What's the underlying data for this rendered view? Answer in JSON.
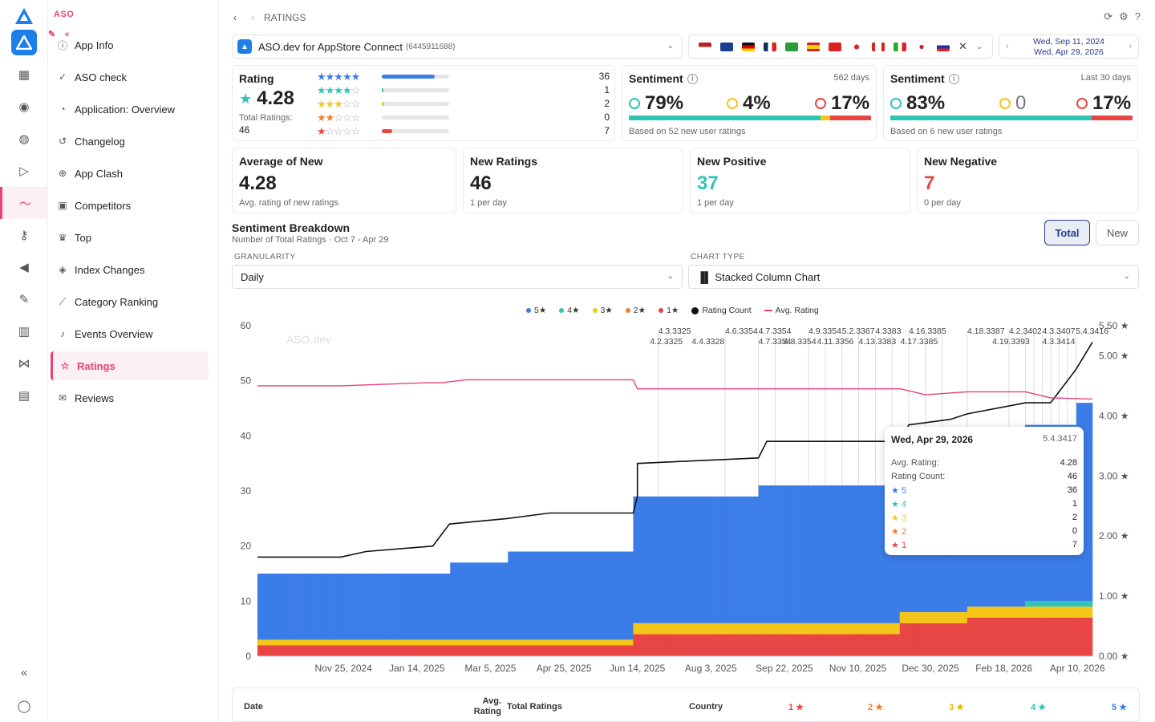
{
  "sidebar": {
    "brand": "ASO",
    "items": [
      {
        "label": "App Info",
        "icon": "info-icon"
      },
      {
        "label": "ASO check",
        "icon": "check-circle-icon"
      },
      {
        "label": "Application: Overview",
        "icon": "overview-icon"
      },
      {
        "label": "Changelog",
        "icon": "history-icon"
      },
      {
        "label": "App Clash",
        "icon": "clash-icon"
      },
      {
        "label": "Competitors",
        "icon": "competitors-icon"
      },
      {
        "label": "Top",
        "icon": "trophy-icon"
      },
      {
        "label": "Index Changes",
        "icon": "index-icon"
      },
      {
        "label": "Category Ranking",
        "icon": "ranking-chart-icon"
      },
      {
        "label": "Events Overview",
        "icon": "bell-icon"
      },
      {
        "label": "Ratings",
        "icon": "star-icon"
      },
      {
        "label": "Reviews",
        "icon": "reviews-icon"
      }
    ],
    "active": "Ratings"
  },
  "header": {
    "breadcrumb": "RATINGS"
  },
  "app_selector": {
    "name": "ASO.dev for AppStore Connect",
    "id": "(6445911688)"
  },
  "date_range": {
    "from": "Wed, Sep 11, 2024",
    "to": "Wed, Apr 29, 2026"
  },
  "rating_card": {
    "title": "Rating",
    "value": "4.28",
    "total_label": "Total Ratings:",
    "total": "46",
    "rows": [
      {
        "stars": 5,
        "count": "36",
        "fill": 0.78,
        "color": "#3b7de8"
      },
      {
        "stars": 4,
        "count": "1",
        "fill": 0.02,
        "color": "#2ec4b6"
      },
      {
        "stars": 3,
        "count": "2",
        "fill": 0.04,
        "color": "#f5c518"
      },
      {
        "stars": 2,
        "count": "0",
        "fill": 0,
        "color": "#f08030"
      },
      {
        "stars": 1,
        "count": "7",
        "fill": 0.15,
        "color": "#e84545"
      }
    ]
  },
  "sentiment_all": {
    "title": "Sentiment",
    "period": "562 days",
    "pos": "79%",
    "neu": "4%",
    "neg": "17%",
    "note": "Based on 52 new user ratings"
  },
  "sentiment_30": {
    "title": "Sentiment",
    "period": "Last 30 days",
    "pos": "83%",
    "neu": "0",
    "neg": "17%",
    "note": "Based on 6 new user ratings"
  },
  "stats": [
    {
      "title": "Average of New",
      "value": "4.28",
      "sub": "Avg. rating of new ratings",
      "color": "#222"
    },
    {
      "title": "New Ratings",
      "value": "46",
      "sub": "1 per day",
      "color": "#222"
    },
    {
      "title": "New Positive",
      "value": "37",
      "sub": "1 per day",
      "color": "#2ec4b6"
    },
    {
      "title": "New Negative",
      "value": "7",
      "sub": "0 per day",
      "color": "#e84545"
    }
  ],
  "breakdown": {
    "title": "Sentiment Breakdown",
    "subtitle": "Number of Total Ratings · Oct 7 - Apr 29",
    "btn_total": "Total",
    "btn_new": "New",
    "granularity_label": "GRANULARITY",
    "granularity": "Daily",
    "chart_type_label": "CHART TYPE",
    "chart_type": "Stacked Column Chart"
  },
  "legend": [
    "5★",
    "4★",
    "3★",
    "2★",
    "1★",
    "Rating Count",
    "Avg. Rating"
  ],
  "watermark": "ASO.dev",
  "tooltip": {
    "date": "Wed, Apr 29, 2026",
    "version": "5.4.3417",
    "avg_label": "Avg. Rating:",
    "avg": "4.28",
    "count_label": "Rating Count:",
    "count": "46",
    "rows": [
      {
        "label": "5",
        "value": "36",
        "color": "#3b7de8"
      },
      {
        "label": "4",
        "value": "1",
        "color": "#2ec4b6"
      },
      {
        "label": "3",
        "value": "2",
        "color": "#f5c518"
      },
      {
        "label": "2",
        "value": "0",
        "color": "#f08030"
      },
      {
        "label": "1",
        "value": "7",
        "color": "#e84545"
      }
    ]
  },
  "version_labels": {
    "row1": [
      "4.3.3325",
      "4.6.3354",
      "4.7.3354",
      "4.9.3354",
      "5.2.3367",
      "4.3383",
      "4.16.3385",
      "4.18.3387",
      "4.2.3402",
      "4.3.3407",
      "5.4.3416"
    ],
    "row2": [
      "4.2.3325",
      "4.4.3328",
      "4.7.3354",
      "4.8.3354",
      "4.11.3356",
      "4.13.3383",
      "4.17.3385",
      "4.19.3393",
      "4.3.3414"
    ]
  },
  "table_header": [
    "Date",
    "Avg. Rating",
    "Total Ratings",
    "Country",
    "1 ★",
    "2 ★",
    "3 ★",
    "4 ★",
    "5 ★"
  ],
  "chart_data": {
    "type": "bar",
    "stacked": true,
    "x": [
      "Nov 25, 2024",
      "Jan 14, 2025",
      "Mar 5, 2025",
      "Apr 25, 2025",
      "Jun 14, 2025",
      "Aug 3, 2025",
      "Sep 22, 2025",
      "Nov 10, 2025",
      "Dec 30, 2025",
      "Feb 18, 2026",
      "Apr 10, 2026"
    ],
    "x_range": [
      "Oct 7, 2024",
      "Apr 29, 2026"
    ],
    "ylim": [
      0,
      60
    ],
    "yticks": [
      0,
      10,
      20,
      30,
      40,
      50,
      60
    ],
    "y2lim": [
      0,
      5.5
    ],
    "y2ticks": [
      "0.00 ★",
      "1.00 ★",
      "2.00 ★",
      "3.00 ★",
      "4.00 ★",
      "5.00 ★",
      "5.50 ★"
    ],
    "series": [
      {
        "name": "1★",
        "color": "#e84545",
        "steps": [
          [
            0,
            2
          ],
          [
            0.45,
            2
          ],
          [
            0.45,
            4
          ],
          [
            0.77,
            4
          ],
          [
            0.77,
            6
          ],
          [
            0.85,
            6
          ],
          [
            0.85,
            7
          ],
          [
            1,
            7
          ]
        ]
      },
      {
        "name": "2★",
        "color": "#f08030",
        "steps": [
          [
            0,
            0
          ],
          [
            1,
            0
          ]
        ]
      },
      {
        "name": "3★",
        "color": "#f5c518",
        "steps": [
          [
            0,
            1
          ],
          [
            0.45,
            1
          ],
          [
            0.45,
            2
          ],
          [
            1,
            2
          ]
        ]
      },
      {
        "name": "4★",
        "color": "#2ec4b6",
        "steps": [
          [
            0,
            0
          ],
          [
            0.92,
            0
          ],
          [
            0.92,
            1
          ],
          [
            1,
            1
          ]
        ]
      },
      {
        "name": "5★",
        "color": "#3b7de8",
        "steps": [
          [
            0,
            12
          ],
          [
            0.23,
            12
          ],
          [
            0.23,
            14
          ],
          [
            0.3,
            14
          ],
          [
            0.3,
            16
          ],
          [
            0.45,
            16
          ],
          [
            0.45,
            23
          ],
          [
            0.6,
            23
          ],
          [
            0.6,
            25
          ],
          [
            0.77,
            25
          ],
          [
            0.77,
            27
          ],
          [
            0.85,
            27
          ],
          [
            0.85,
            29
          ],
          [
            0.92,
            29
          ],
          [
            0.92,
            32
          ],
          [
            0.98,
            32
          ],
          [
            0.98,
            36
          ],
          [
            1,
            36
          ]
        ]
      }
    ],
    "rating_count": [
      [
        0,
        18
      ],
      [
        0.1,
        18
      ],
      [
        0.13,
        19
      ],
      [
        0.21,
        20
      ],
      [
        0.22,
        22
      ],
      [
        0.23,
        24
      ],
      [
        0.3,
        25
      ],
      [
        0.35,
        26
      ],
      [
        0.45,
        26
      ],
      [
        0.455,
        29
      ],
      [
        0.455,
        35
      ],
      [
        0.6,
        36
      ],
      [
        0.61,
        39
      ],
      [
        0.77,
        39
      ],
      [
        0.78,
        42
      ],
      [
        0.83,
        43
      ],
      [
        0.85,
        44
      ],
      [
        0.92,
        46
      ],
      [
        0.95,
        46
      ],
      [
        0.98,
        52
      ],
      [
        1,
        57
      ]
    ],
    "avg_rating": [
      [
        0,
        4.5
      ],
      [
        0.1,
        4.5
      ],
      [
        0.2,
        4.55
      ],
      [
        0.22,
        4.55
      ],
      [
        0.25,
        4.6
      ],
      [
        0.45,
        4.6
      ],
      [
        0.455,
        4.45
      ],
      [
        0.6,
        4.45
      ],
      [
        0.77,
        4.45
      ],
      [
        0.8,
        4.35
      ],
      [
        0.85,
        4.4
      ],
      [
        0.92,
        4.4
      ],
      [
        0.95,
        4.3
      ],
      [
        1,
        4.28
      ]
    ]
  }
}
